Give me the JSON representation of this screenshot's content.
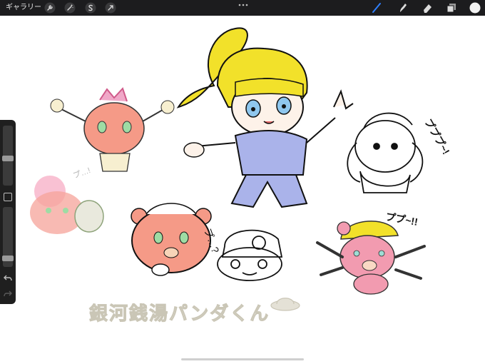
{
  "topbar": {
    "gallery_label": "ギャラリー",
    "tools_left": [
      "wrench-icon",
      "magic-wand-icon",
      "selection-s-icon",
      "transform-arrow-icon"
    ],
    "tools_right": [
      "brush-icon",
      "smudge-icon",
      "eraser-icon",
      "layers-icon",
      "color-swatch-icon"
    ],
    "active_tool": "brush-icon",
    "accent_color": "#2f80ff",
    "current_color": "#f2f2f2"
  },
  "sidebar": {
    "size_slider_level": 0.45,
    "opacity_slider_level": 0.1,
    "controls": [
      "modify-button",
      "undo-icon",
      "redo-icon"
    ]
  },
  "canvas": {
    "sfx_1": "プ…!",
    "sfx_2": "プ…?",
    "sfx_3": "プププ~!",
    "sfx_4": "ププ~!!",
    "caption": "銀河銭湯パンダくん"
  }
}
